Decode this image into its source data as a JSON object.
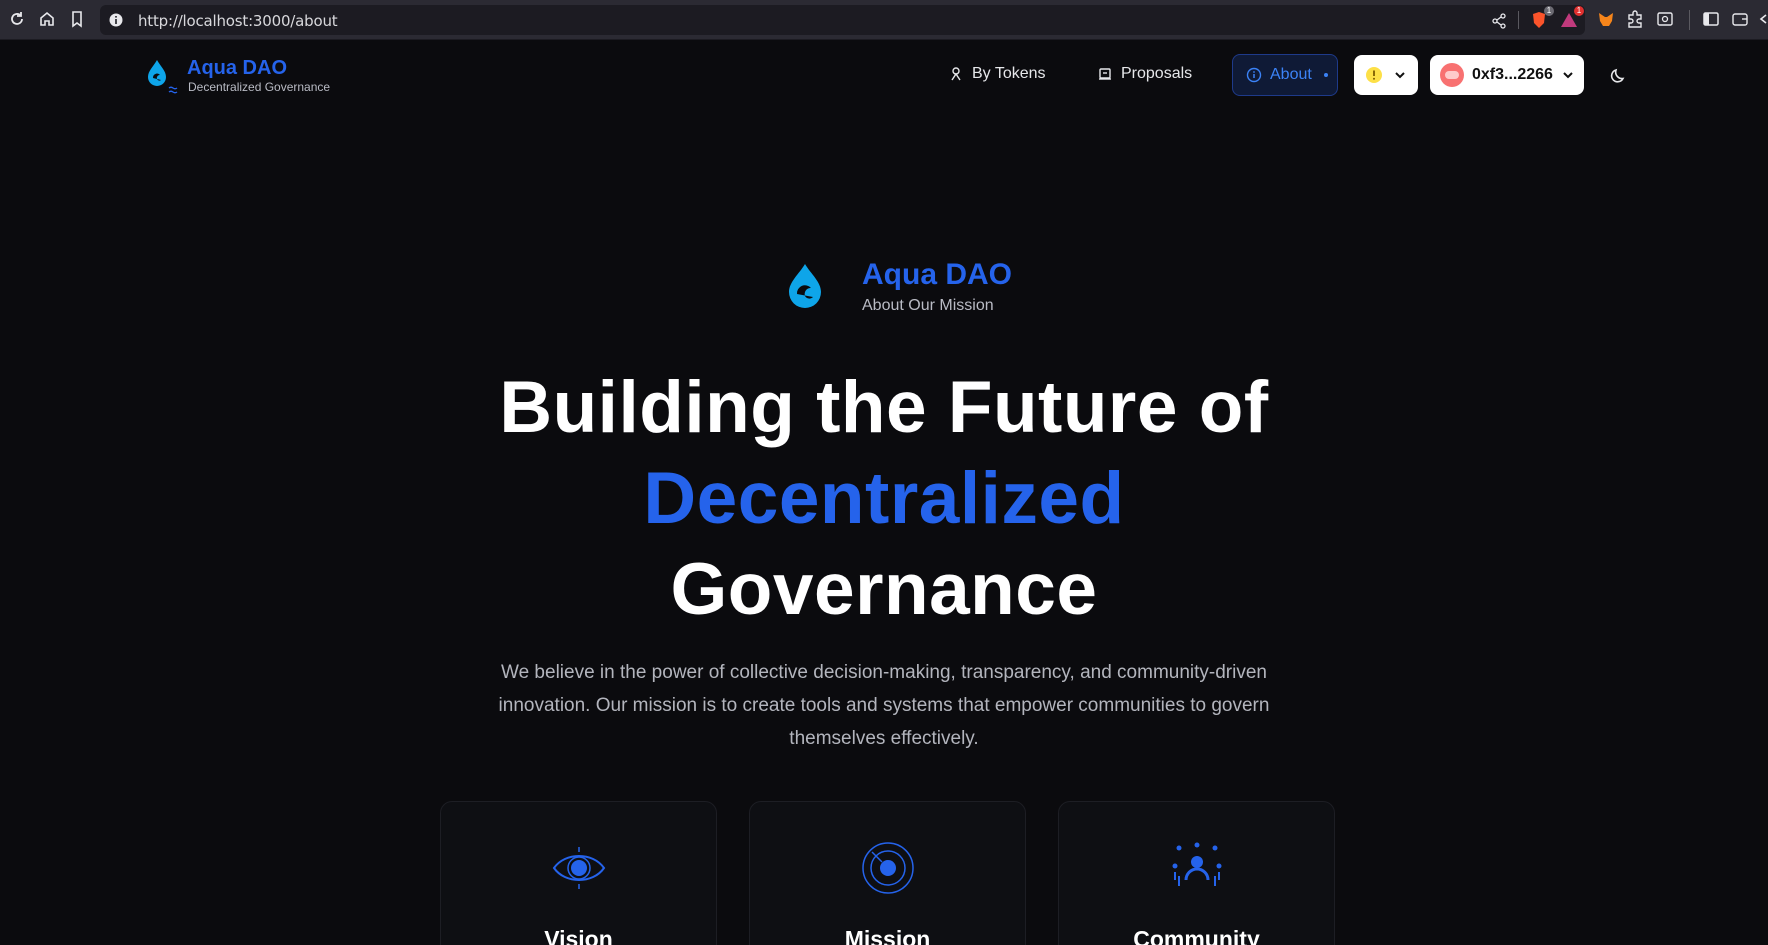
{
  "browser": {
    "url": "http://localhost:3000/about",
    "brave_badge": "1",
    "alert_badge": "1"
  },
  "header": {
    "brand": "Aqua DAO",
    "tagline": "Decentralized Governance",
    "nav": [
      {
        "label": "By Tokens",
        "icon": "tokens-icon"
      },
      {
        "label": "Proposals",
        "icon": "proposals-icon"
      },
      {
        "label": "About",
        "icon": "info-icon",
        "active": true
      }
    ],
    "wallet_address": "0xf3...2266"
  },
  "hero": {
    "brand": "Aqua DAO",
    "brand_sub": "About Our Mission",
    "headline_line1": "Building the Future of",
    "headline_highlight": "Decentralized",
    "headline_line3": "Governance",
    "description": "We believe in the power of collective decision-making, transparency, and community-driven innovation. Our mission is to create tools and systems that empower communities to govern themselves effectively."
  },
  "cards": [
    {
      "title": "Vision",
      "icon": "eye-icon"
    },
    {
      "title": "Mission",
      "icon": "target-icon"
    },
    {
      "title": "Community",
      "icon": "community-icon"
    }
  ],
  "colors": {
    "accent": "#2563eb",
    "background": "#0b0b0e",
    "muted_text": "#b3b5bd"
  }
}
